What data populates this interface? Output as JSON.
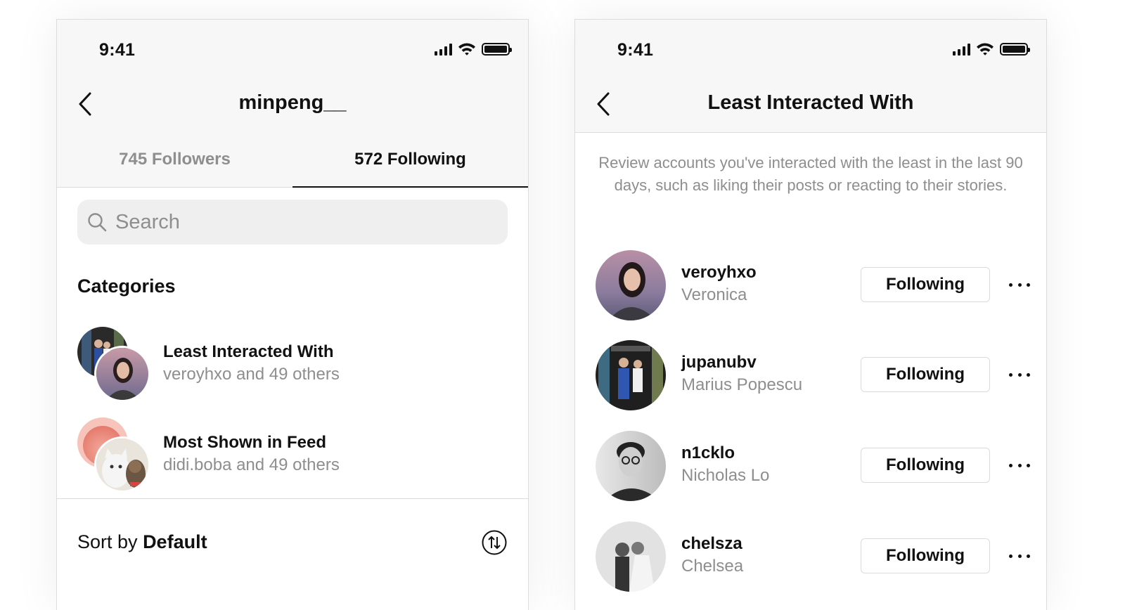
{
  "colors": {
    "text_primary": "#111111",
    "text_secondary": "#8e8e8e",
    "divider": "#dbdbdb",
    "header_bg": "#f7f7f7",
    "search_bg": "#efefef"
  },
  "left_screen": {
    "status_bar": {
      "time": "9:41"
    },
    "header": {
      "title": "minpeng__",
      "back_icon": "chevron-left-icon"
    },
    "tabs": [
      {
        "label": "745 Followers",
        "active": false
      },
      {
        "label": "572 Following",
        "active": true
      }
    ],
    "search": {
      "placeholder": "Search",
      "icon": "search-icon"
    },
    "categories_title": "Categories",
    "categories": [
      {
        "title": "Least Interacted With",
        "subtitle": "veroyhxo and 49 others"
      },
      {
        "title": "Most Shown in Feed",
        "subtitle": "didi.boba and 49 others"
      }
    ],
    "sort": {
      "prefix": "Sort by",
      "value": "Default",
      "icon": "sort-arrows-icon"
    }
  },
  "right_screen": {
    "status_bar": {
      "time": "9:41"
    },
    "header": {
      "title": "Least Interacted With",
      "back_icon": "chevron-left-icon"
    },
    "description": "Review accounts you've interacted with the least in the last 90 days, such as liking their posts or reacting to their stories.",
    "users": [
      {
        "username": "veroyhxo",
        "name": "Veronica",
        "button": "Following"
      },
      {
        "username": "jupanubv",
        "name": "Marius Popescu",
        "button": "Following"
      },
      {
        "username": "n1cklo",
        "name": "Nicholas Lo",
        "button": "Following"
      },
      {
        "username": "chelsza",
        "name": "Chelsea",
        "button": "Following"
      }
    ]
  }
}
